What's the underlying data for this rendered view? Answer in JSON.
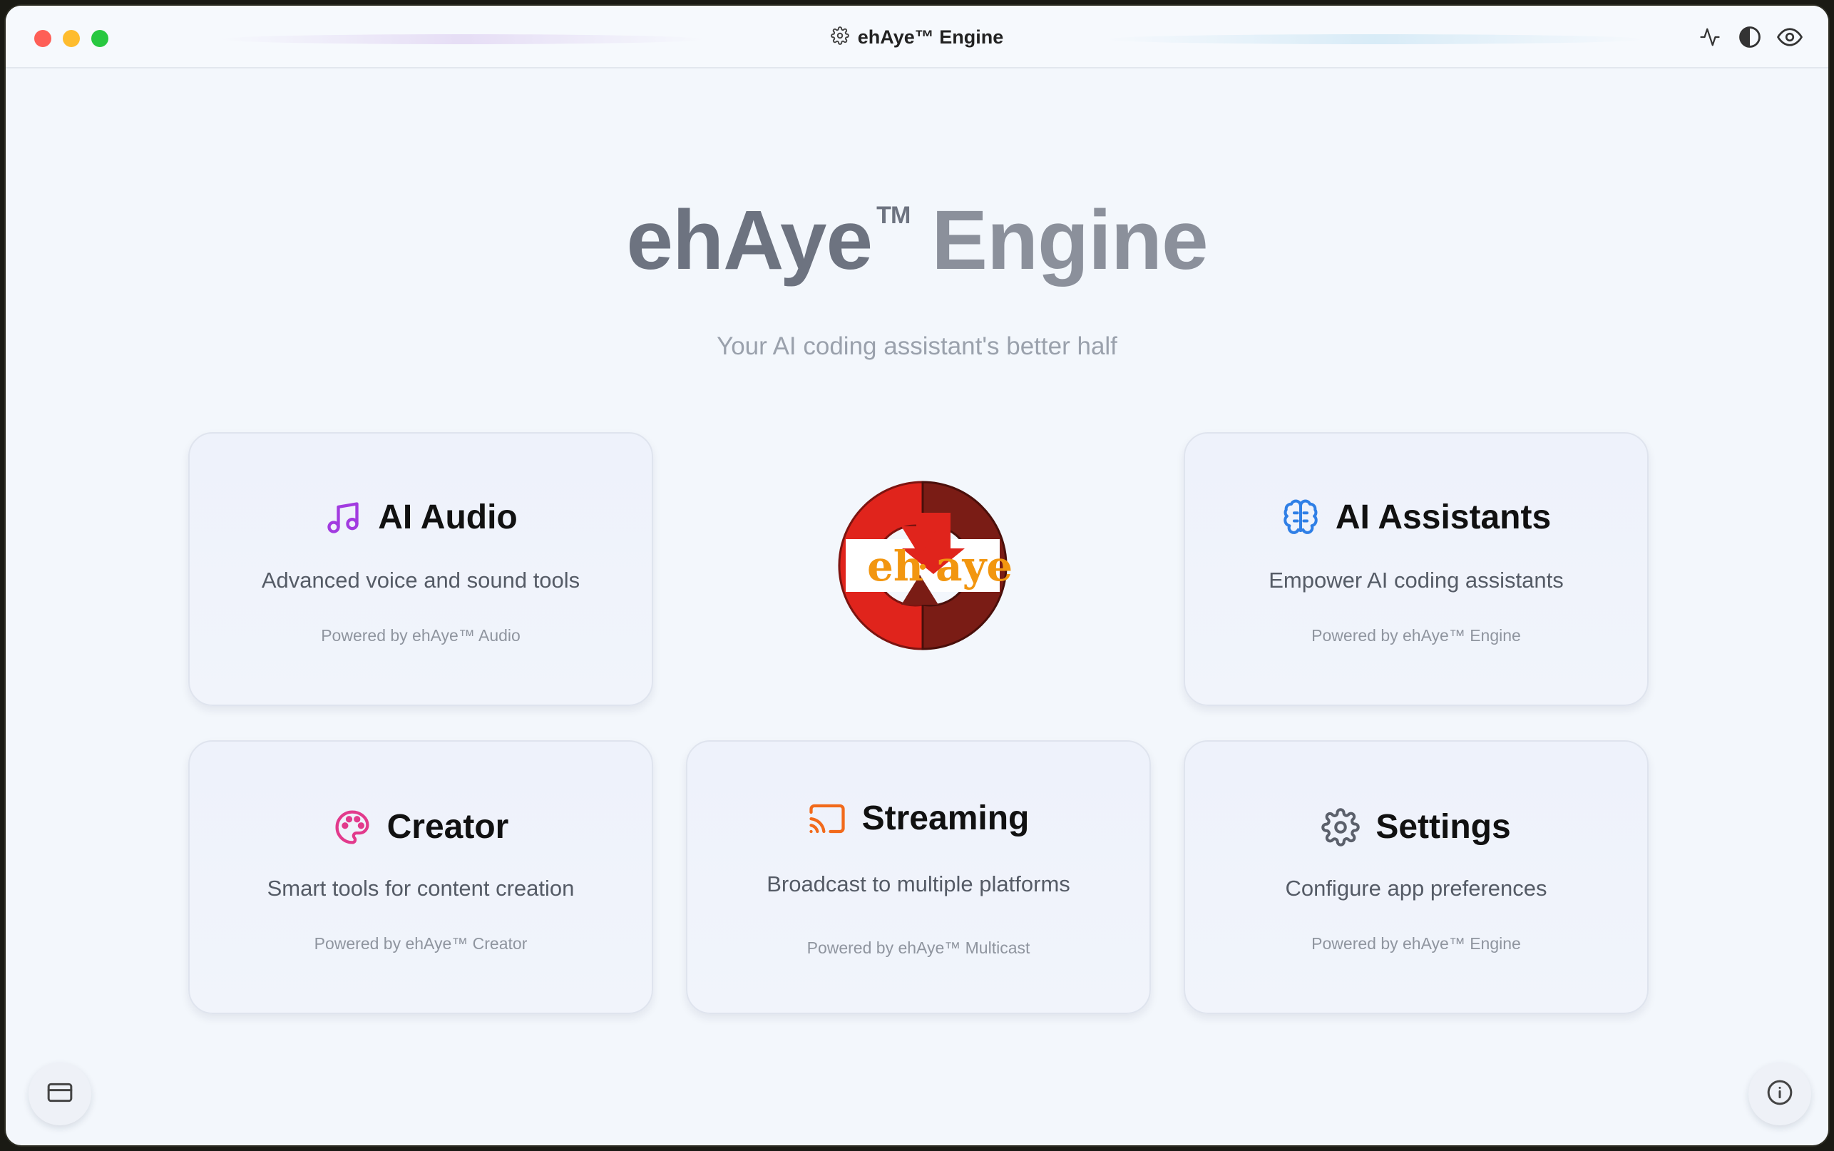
{
  "window": {
    "title": "ehAye™ Engine"
  },
  "hero": {
    "brand": "ehAye",
    "tm": "TM",
    "engine": "Engine",
    "subtitle": "Your AI coding assistant's better half"
  },
  "logo": {
    "left": "eh",
    "dot": "·",
    "right": "aye"
  },
  "cards": [
    {
      "title": "AI Audio",
      "description": "Advanced voice and sound tools",
      "footer": "Powered by ehAye™ Audio",
      "icon": "music-note-icon",
      "color": "#a23be0"
    },
    {
      "title": "AI Assistants",
      "description": "Empower AI coding assistants",
      "footer": "Powered by ehAye™ Engine",
      "icon": "brain-icon",
      "color": "#2f7fe6"
    },
    {
      "title": "Creator",
      "description": "Smart tools for content creation",
      "footer": "Powered by ehAye™ Creator",
      "icon": "palette-icon",
      "color": "#e23a8c"
    },
    {
      "title": "Streaming",
      "description": "Broadcast to multiple platforms",
      "footer": "Powered by ehAye™ Multicast",
      "icon": "cast-icon",
      "color": "#f26a1b"
    },
    {
      "title": "Settings",
      "description": "Configure app preferences",
      "footer": "Powered by ehAye™ Engine",
      "icon": "gear-icon",
      "color": "#5b606b"
    }
  ]
}
